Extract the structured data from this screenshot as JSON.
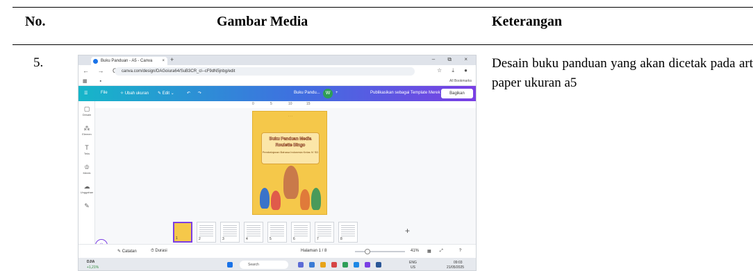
{
  "table": {
    "headers": [
      "No.",
      "Gambar Media",
      "Keterangan"
    ],
    "row": {
      "no": "5.",
      "description": "Desain buku panduan yang akan dicetak pada art paper ukuran a5"
    }
  },
  "screenshot": {
    "browser": {
      "tab_title": "Buku Panduan - A5 - Canva",
      "tab_close": "×",
      "new_tab": "+",
      "window_controls": "– ⧉ ×",
      "nav_glyphs": "← → C",
      "url": "canva.com/design/DAGoiura64/SuB3CR_cl--cF9dN5jnbg/edit",
      "extension_glyphs": "☆ ⤓ ●",
      "all_bookmarks": "All Bookmarks"
    },
    "canva_toolbar": {
      "menu": "☰",
      "file": "File",
      "resize": "✧ Ubah ukuran",
      "edit": "✎ Edit ⌄",
      "undo": "↶",
      "redo": "↷",
      "doc_name": "Buku Pandu...",
      "avatar": "W",
      "plus": "+",
      "publish": "Publikasikan sebagai Template Merek",
      "share": "Bagikan"
    },
    "side_panel": [
      {
        "icon": "▢",
        "label": "Desain"
      },
      {
        "icon": "⁂",
        "label": "Elemen"
      },
      {
        "icon": "T",
        "label": "Teks"
      },
      {
        "icon": "♔",
        "label": "Merek"
      },
      {
        "icon": "☁",
        "label": "Unggahan"
      },
      {
        "icon": "✎",
        "label": ""
      }
    ],
    "ruler_ticks": [
      "0",
      "5",
      "10",
      "15"
    ],
    "page": {
      "header_text": "· · ·",
      "title": "Buku Panduan Media Roulette Bingo",
      "subtitle": "Pembelajaran Bahasa Indonesia Kelas IV SD"
    },
    "thumbnails": [
      "1",
      "2",
      "3",
      "4",
      "5",
      "6",
      "7",
      "8"
    ],
    "add_page": "+",
    "footer": {
      "notes": "Catatan",
      "duration": "Durasi",
      "page_count": "Halaman 1 / 8",
      "zoom": "41%",
      "grid_view": "▦",
      "fullscreen": "⤢",
      "help": "?"
    },
    "help_button": "✳",
    "zoom_level": 0.2,
    "taskbar": {
      "stock_name": "DJIA",
      "stock_change": "+1,21%",
      "search": "Search",
      "language": "ENG",
      "region": "US",
      "time": "09:03",
      "date": "21/05/2025"
    }
  }
}
